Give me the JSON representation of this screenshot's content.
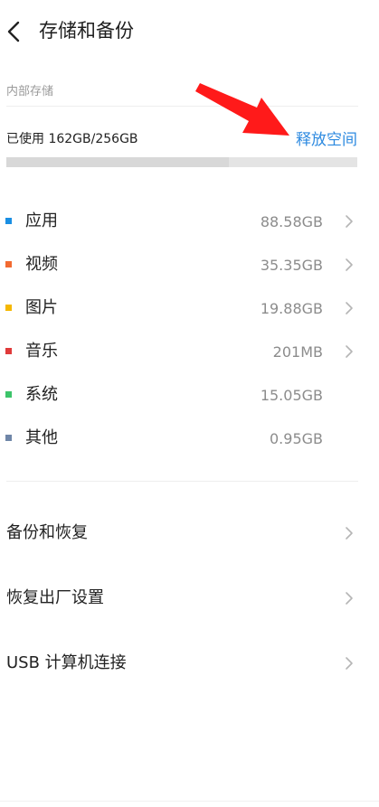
{
  "header": {
    "title": "存储和备份",
    "back_icon": "back-arrow-icon"
  },
  "storage": {
    "section_label": "内部存储",
    "usage_text": "已使用 162GB/256GB",
    "used_fraction": 0.633,
    "free_space_label": "释放空间"
  },
  "categories": [
    {
      "name": "应用",
      "size": "88.58GB",
      "color": "#1a8fe3",
      "has_chevron": true
    },
    {
      "name": "视频",
      "size": "35.35GB",
      "color": "#f26a31",
      "has_chevron": true
    },
    {
      "name": "图片",
      "size": "19.88GB",
      "color": "#f5b800",
      "has_chevron": true
    },
    {
      "name": "音乐",
      "size": "201MB",
      "color": "#e03a3a",
      "has_chevron": true
    },
    {
      "name": "系统",
      "size": "15.05GB",
      "color": "#3cc46a",
      "has_chevron": false
    },
    {
      "name": "其他",
      "size": "0.95GB",
      "color": "#6f86a8",
      "has_chevron": false
    }
  ],
  "menu": [
    {
      "label": "备份和恢复"
    },
    {
      "label": "恢复出厂设置"
    },
    {
      "label": "USB 计算机连接"
    }
  ],
  "annotation": {
    "arrow_color": "#ff1a1a"
  }
}
